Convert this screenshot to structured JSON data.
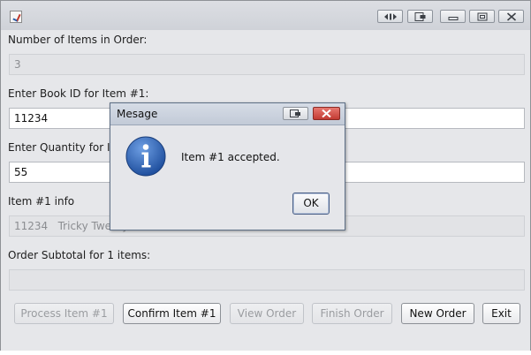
{
  "window": {
    "app_icon": "java-cup-icon",
    "title_buttons": [
      "swap-icon",
      "restore-menu-icon",
      "minimize-icon",
      "maximize-icon",
      "close-icon"
    ]
  },
  "form": {
    "items_label": "Number of Items in Order:",
    "items_value": "3",
    "book_id_label": "Enter Book ID for Item #1:",
    "book_id_value": "11234",
    "quantity_label": "Enter Quantity for Item #1:",
    "quantity_value": "55",
    "info_label": "Item #1 info",
    "info_value": "11234   Tricky Twenty",
    "subtotal_label": "Order Subtotal for 1 items:",
    "subtotal_value": ""
  },
  "buttons": {
    "process": "Process Item #1",
    "confirm": "Confirm Item #1",
    "view": "View Order",
    "finish": "Finish Order",
    "new": "New Order",
    "exit": "Exit"
  },
  "dialog": {
    "title": "Mesage",
    "message": "Item #1 accepted.",
    "ok": "OK",
    "icon": "information-icon",
    "accent": "#2b5fae",
    "close_color": "#c9403a"
  }
}
